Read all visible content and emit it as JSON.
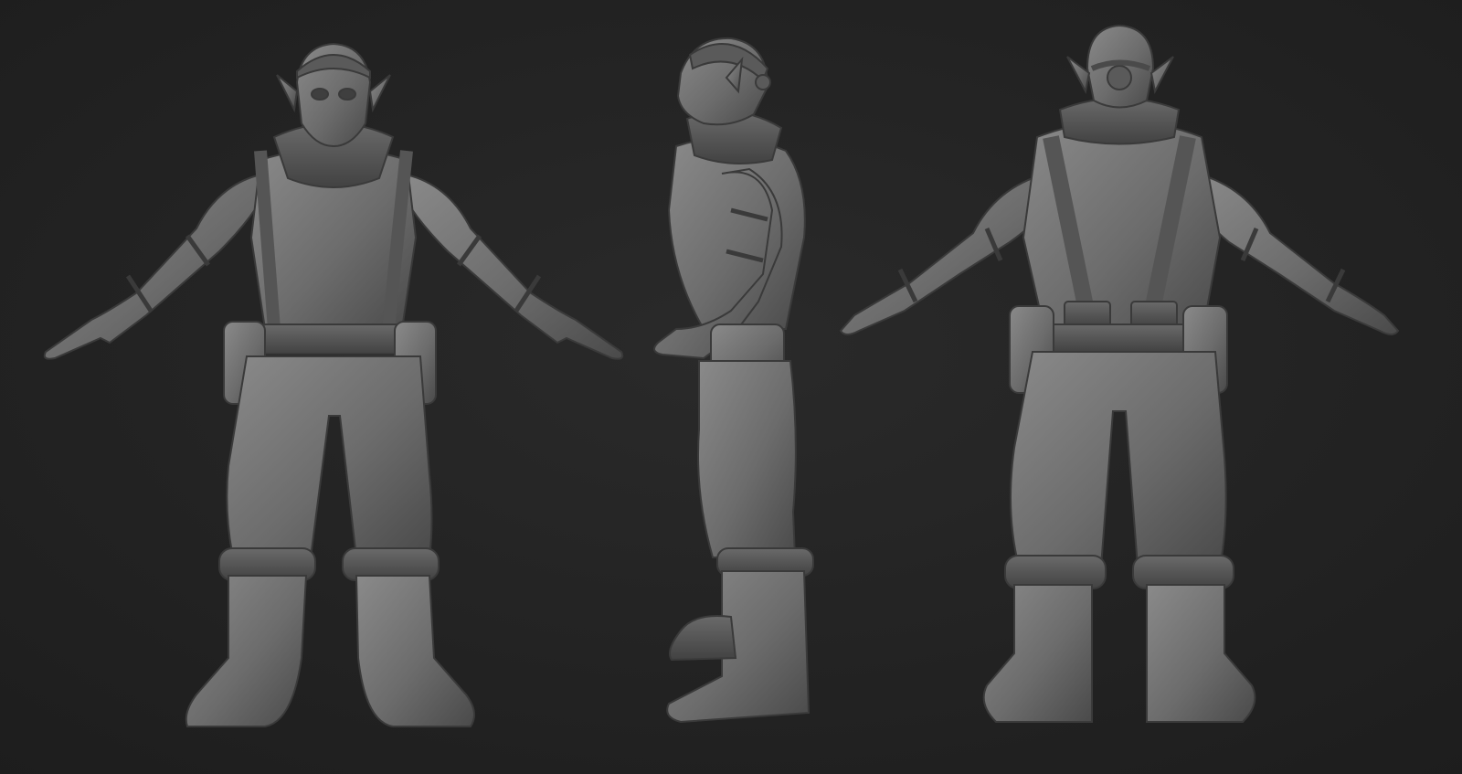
{
  "scene": {
    "background_color": "#242424",
    "model_color": "#6e6e6e",
    "model_shadow_color": "#3c3c3c",
    "model_highlight_color": "#8e8e8e",
    "views": [
      {
        "id": "front",
        "name": "front-view"
      },
      {
        "id": "side",
        "name": "side-view"
      },
      {
        "id": "back",
        "name": "back-view"
      }
    ]
  }
}
